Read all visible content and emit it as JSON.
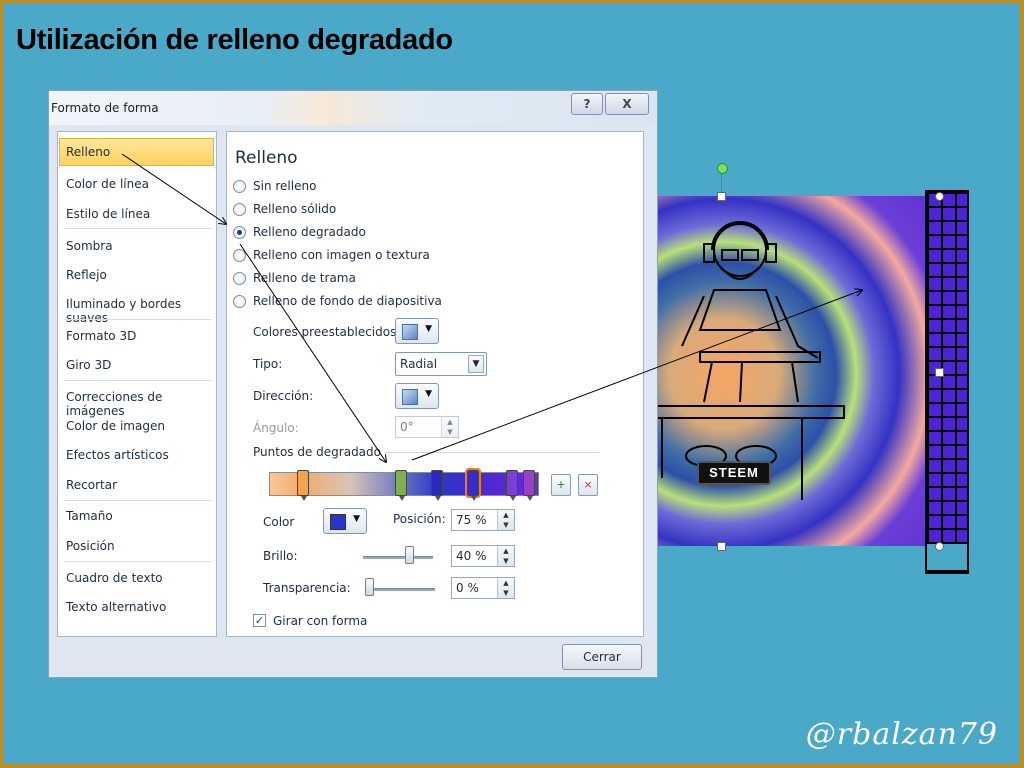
{
  "slide": {
    "title": "Utilización de relleno degradado",
    "watermark": "@rbalzan79"
  },
  "artwork": {
    "sticker_text": "STEEM"
  },
  "dialog": {
    "title": "Formato de forma",
    "help_label": "?",
    "close_label": "X",
    "nav_items": [
      "Relleno",
      "Color de línea",
      "Estilo de línea",
      "Sombra",
      "Reflejo",
      "Iluminado y bordes suaves",
      "Formato 3D",
      "Giro 3D",
      "Correcciones de imágenes",
      "Color de imagen",
      "Efectos artísticos",
      "Recortar",
      "Tamaño",
      "Posición",
      "Cuadro de texto",
      "Texto alternativo"
    ],
    "selected_nav": "Relleno",
    "panel_title": "Relleno",
    "fill_options": [
      "Sin relleno",
      "Relleno sólido",
      "Relleno degradado",
      "Relleno con imagen o textura",
      "Relleno de trama",
      "Relleno de fondo de diapositiva"
    ],
    "selected_fill": "Relleno degradado",
    "preset_colors_label": "Colores preestablecidos:",
    "type_label": "Tipo:",
    "type_value": "Radial",
    "direction_label": "Dirección:",
    "angle_label": "Ángulo:",
    "angle_value": "0°",
    "gradient_stops_label": "Puntos de degradado",
    "color_label": "Color",
    "position_label": "Posición:",
    "position_value": "75 %",
    "brightness_label": "Brillo:",
    "brightness_value": "40 %",
    "transparency_label": "Transparencia:",
    "transparency_value": "0 %",
    "rotate_with_shape_label": "Girar con forma",
    "rotate_with_shape_checked": true,
    "close_button": "Cerrar"
  },
  "colors": {
    "slide_background": "#4aa9c8",
    "slide_border": "#b8902a",
    "nav_selected": "#ffd25e",
    "stop_selected_outline": "#f07a1a"
  }
}
